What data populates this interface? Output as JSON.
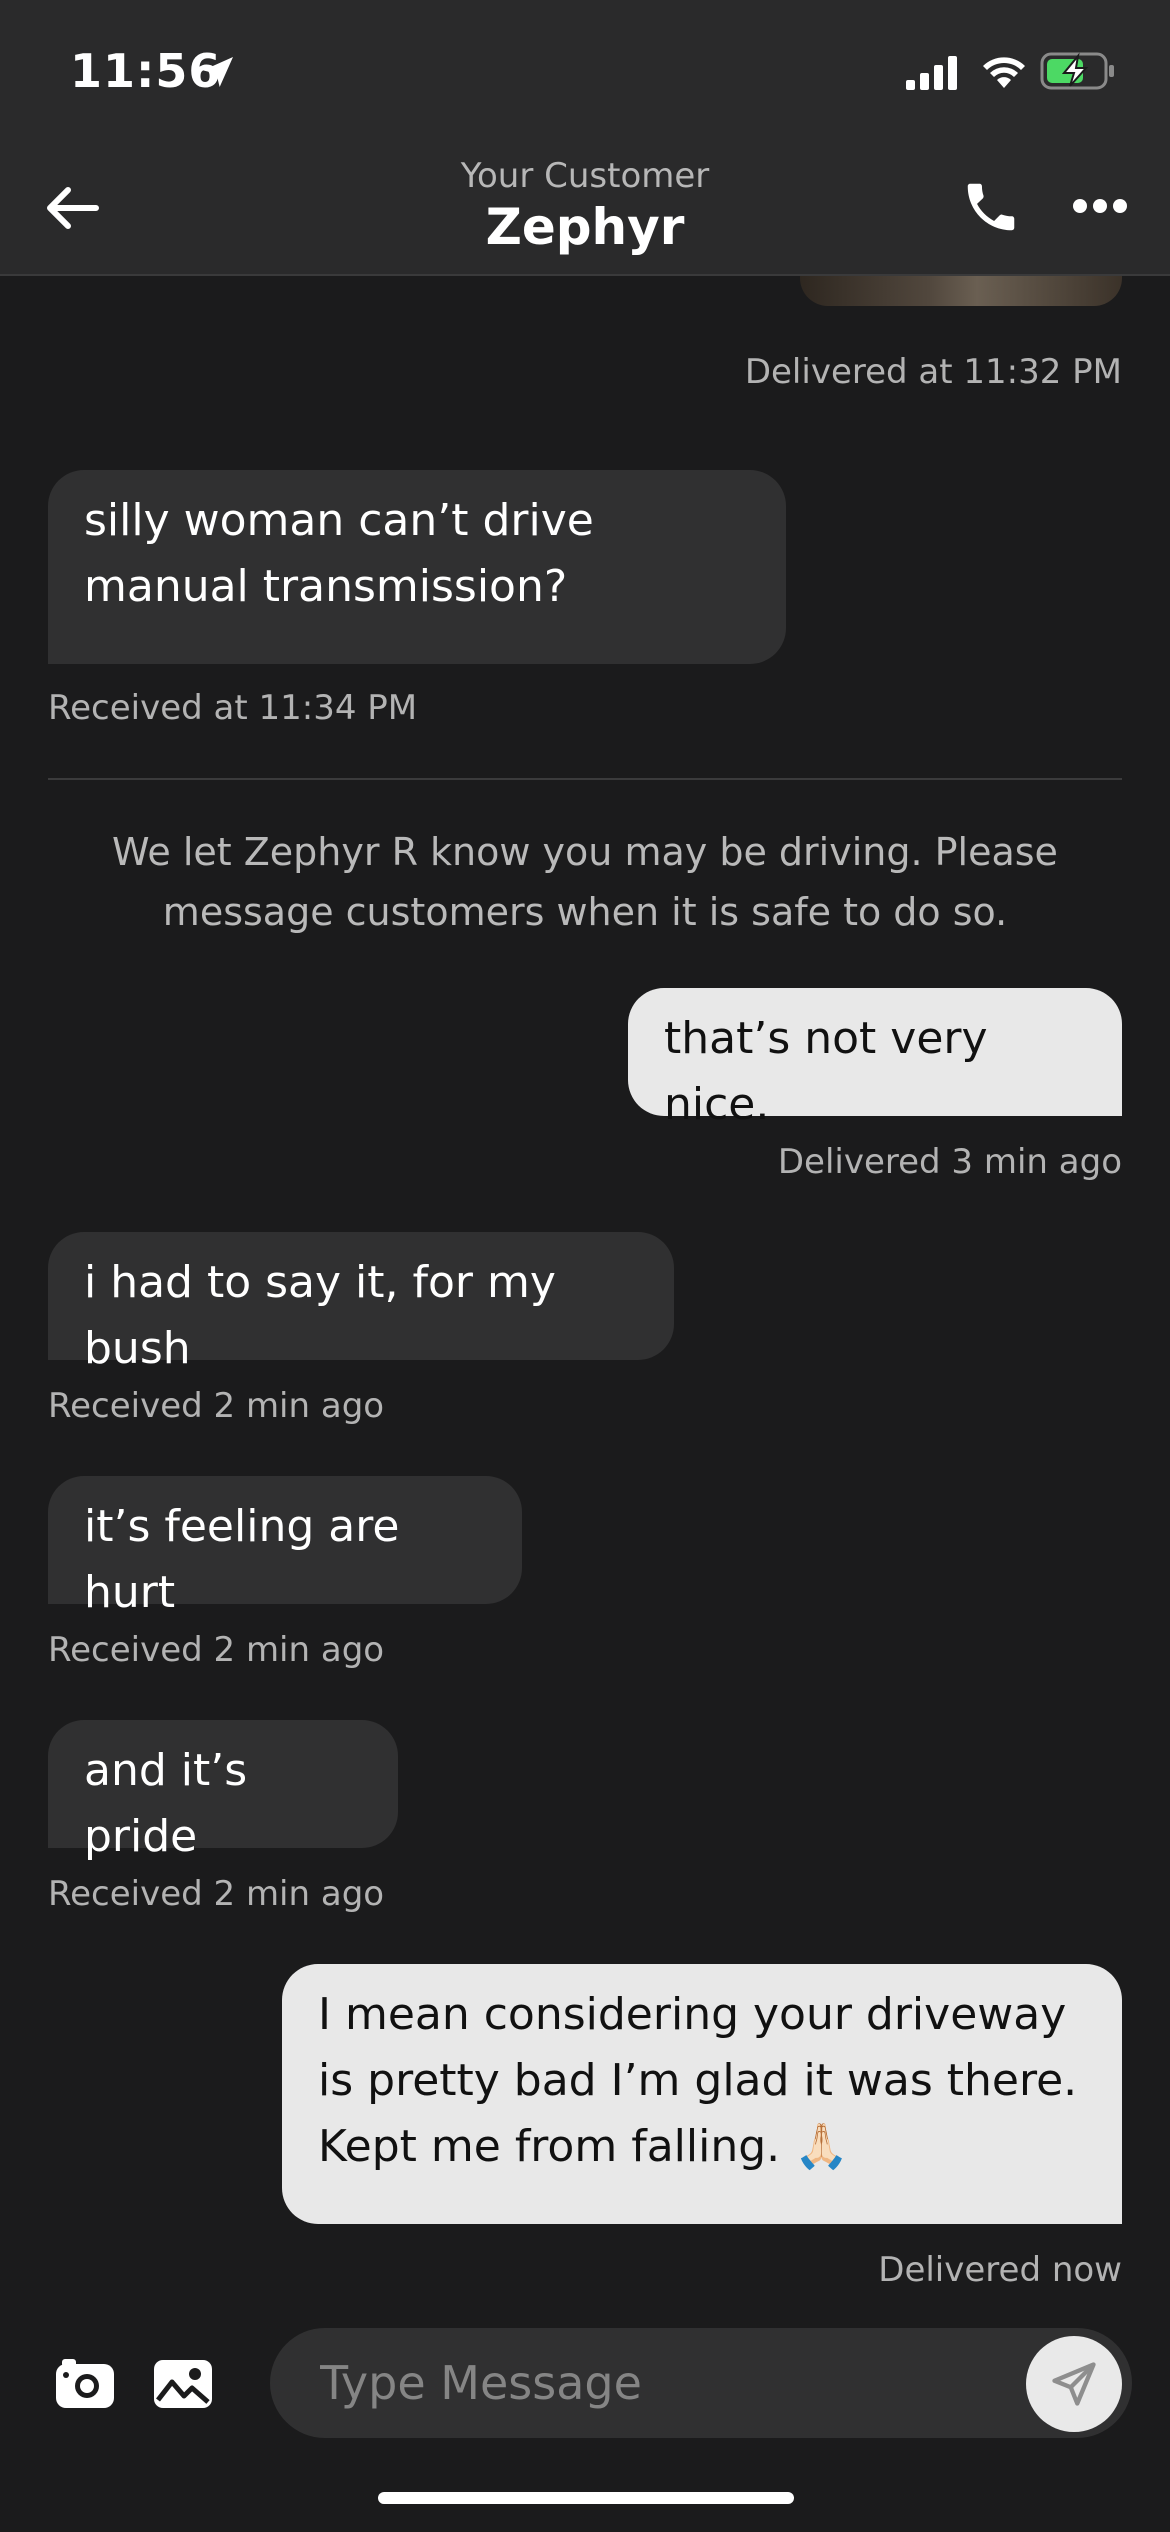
{
  "status_bar": {
    "time": "11:56"
  },
  "header": {
    "subtitle": "Your Customer",
    "title": "Zephyr"
  },
  "messages": [
    {
      "text": "silly woman can’t drive manual transmission?",
      "meta": "Received at 11:34 PM"
    },
    {
      "text": "that’s not very nice.",
      "meta": "Delivered 3 min ago"
    },
    {
      "text": "i had to say it, for my bush",
      "meta": "Received 2 min ago"
    },
    {
      "text": "it’s feeling are hurt",
      "meta": "Received 2 min ago"
    },
    {
      "text": "and it’s pride",
      "meta": "Received 2 min ago"
    },
    {
      "text": "I mean considering your driveway is pretty bad I’m glad it was there. Kept me from falling. 🙏🏻",
      "meta": "Delivered now"
    }
  ],
  "top_meta": "Delivered at 11:32 PM",
  "notice": "We let Zephyr R know you may be driving. Please message customers when it is safe to do so.",
  "composer": {
    "placeholder": "Type Message"
  },
  "colors": {
    "background": "#1b1b1c",
    "bar": "#2a2a2b",
    "incoming": "#303031",
    "outgoing": "#e8e8e8",
    "battery": "#4cd964"
  }
}
